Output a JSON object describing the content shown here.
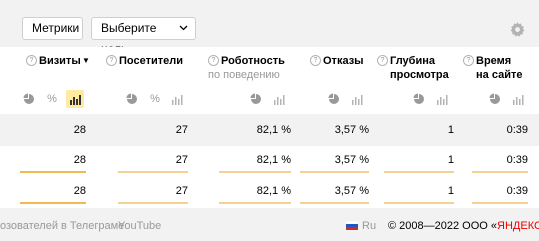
{
  "toolbar": {
    "metrics_label": "Метрики",
    "goal_label": "Выберите цель"
  },
  "columns": [
    {
      "title": "Визиты",
      "sub": ""
    },
    {
      "title": "Посетители",
      "sub": ""
    },
    {
      "title": "Роботность",
      "sub": "по поведению"
    },
    {
      "title": "Отказы",
      "sub": ""
    },
    {
      "title": "Глубина",
      "sub": "просмотра"
    },
    {
      "title": "Время",
      "sub": "на сайте"
    }
  ],
  "sort_indicator": "▼",
  "view_icons": [
    "pie-chart-icon",
    "percent-icon",
    "bar-chart-icon"
  ],
  "totals": {
    "visits": "28",
    "visitors": "27",
    "robots": "82,1 %",
    "bounces": "3,57 %",
    "depth": "1",
    "time": "0:39"
  },
  "rows": [
    {
      "visits": "28",
      "visitors": "27",
      "robots": "82,1 %",
      "bounces": "3,57 %",
      "depth": "1",
      "time": "0:39"
    },
    {
      "visits": "28",
      "visitors": "27",
      "robots": "82,1 %",
      "bounces": "3,57 %",
      "depth": "1",
      "time": "0:39"
    }
  ],
  "footer": {
    "telegram_link": "озователей в Телеграме",
    "youtube_link": "YouTube",
    "language": "Ru",
    "copyright_prefix": "© 2008—2022 ООО «",
    "brand": "ЯНДЕКС",
    "copyright_suffix": "»"
  },
  "colors": {
    "accent_bar": "#f2b951",
    "bar_light": "#f7d193",
    "brand_red": "#e00000",
    "active_icon_bg": "#ffeba0"
  }
}
